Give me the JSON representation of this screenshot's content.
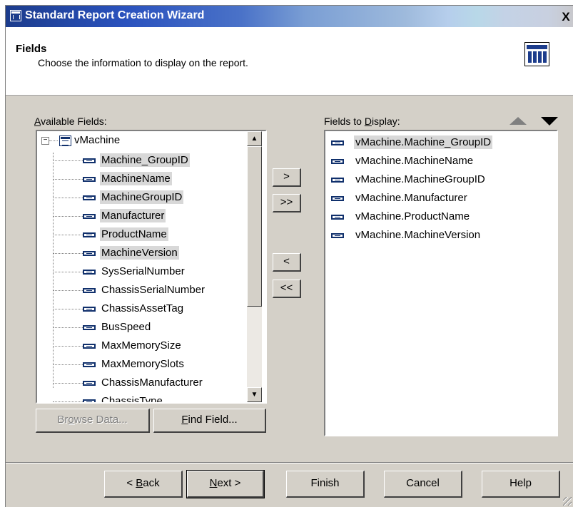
{
  "window": {
    "title": "Standard Report Creation Wizard",
    "close_label": "X"
  },
  "header": {
    "title": "Fields",
    "subtitle": "Choose the information to display on the report."
  },
  "available": {
    "label_pre": "",
    "label_key": "A",
    "label_post": "vailable Fields:",
    "root": "vMachine",
    "items": [
      {
        "label": "Machine_GroupID",
        "selected": true
      },
      {
        "label": "MachineName",
        "selected": true
      },
      {
        "label": "MachineGroupID",
        "selected": true
      },
      {
        "label": "Manufacturer",
        "selected": true
      },
      {
        "label": "ProductName",
        "selected": true
      },
      {
        "label": "MachineVersion",
        "selected": true
      },
      {
        "label": "SysSerialNumber",
        "selected": false
      },
      {
        "label": "ChassisSerialNumber",
        "selected": false
      },
      {
        "label": "ChassisAssetTag",
        "selected": false
      },
      {
        "label": "BusSpeed",
        "selected": false
      },
      {
        "label": "MaxMemorySize",
        "selected": false
      },
      {
        "label": "MaxMemorySlots",
        "selected": false
      },
      {
        "label": "ChassisManufacturer",
        "selected": false
      },
      {
        "label": "ChassisType",
        "selected": false
      }
    ]
  },
  "display": {
    "label_pre": "Fields to ",
    "label_key": "D",
    "label_post": "isplay:",
    "items": [
      {
        "label": "vMachine.Machine_GroupID",
        "selected": true
      },
      {
        "label": "vMachine.MachineName",
        "selected": false
      },
      {
        "label": "vMachine.MachineGroupID",
        "selected": false
      },
      {
        "label": "vMachine.Manufacturer",
        "selected": false
      },
      {
        "label": "vMachine.ProductName",
        "selected": false
      },
      {
        "label": "vMachine.MachineVersion",
        "selected": false
      }
    ]
  },
  "transfer": {
    "add_one": ">",
    "add_all": ">>",
    "remove_one": "<",
    "remove_all": "<<"
  },
  "buttons": {
    "browse_pre": "Br",
    "browse_key": "o",
    "browse_post": "wse Data...",
    "find_pre": "",
    "find_key": "F",
    "find_post": "ind Field...",
    "back_pre": "< ",
    "back_key": "B",
    "back_post": "ack",
    "next_pre": "",
    "next_key": "N",
    "next_post": "ext >",
    "finish": "Finish",
    "cancel": "Cancel",
    "help": "Help"
  },
  "icons": {
    "sort_up": "triangle-up-icon",
    "sort_down": "triangle-down-icon",
    "field": "field-icon",
    "table": "table-icon"
  }
}
